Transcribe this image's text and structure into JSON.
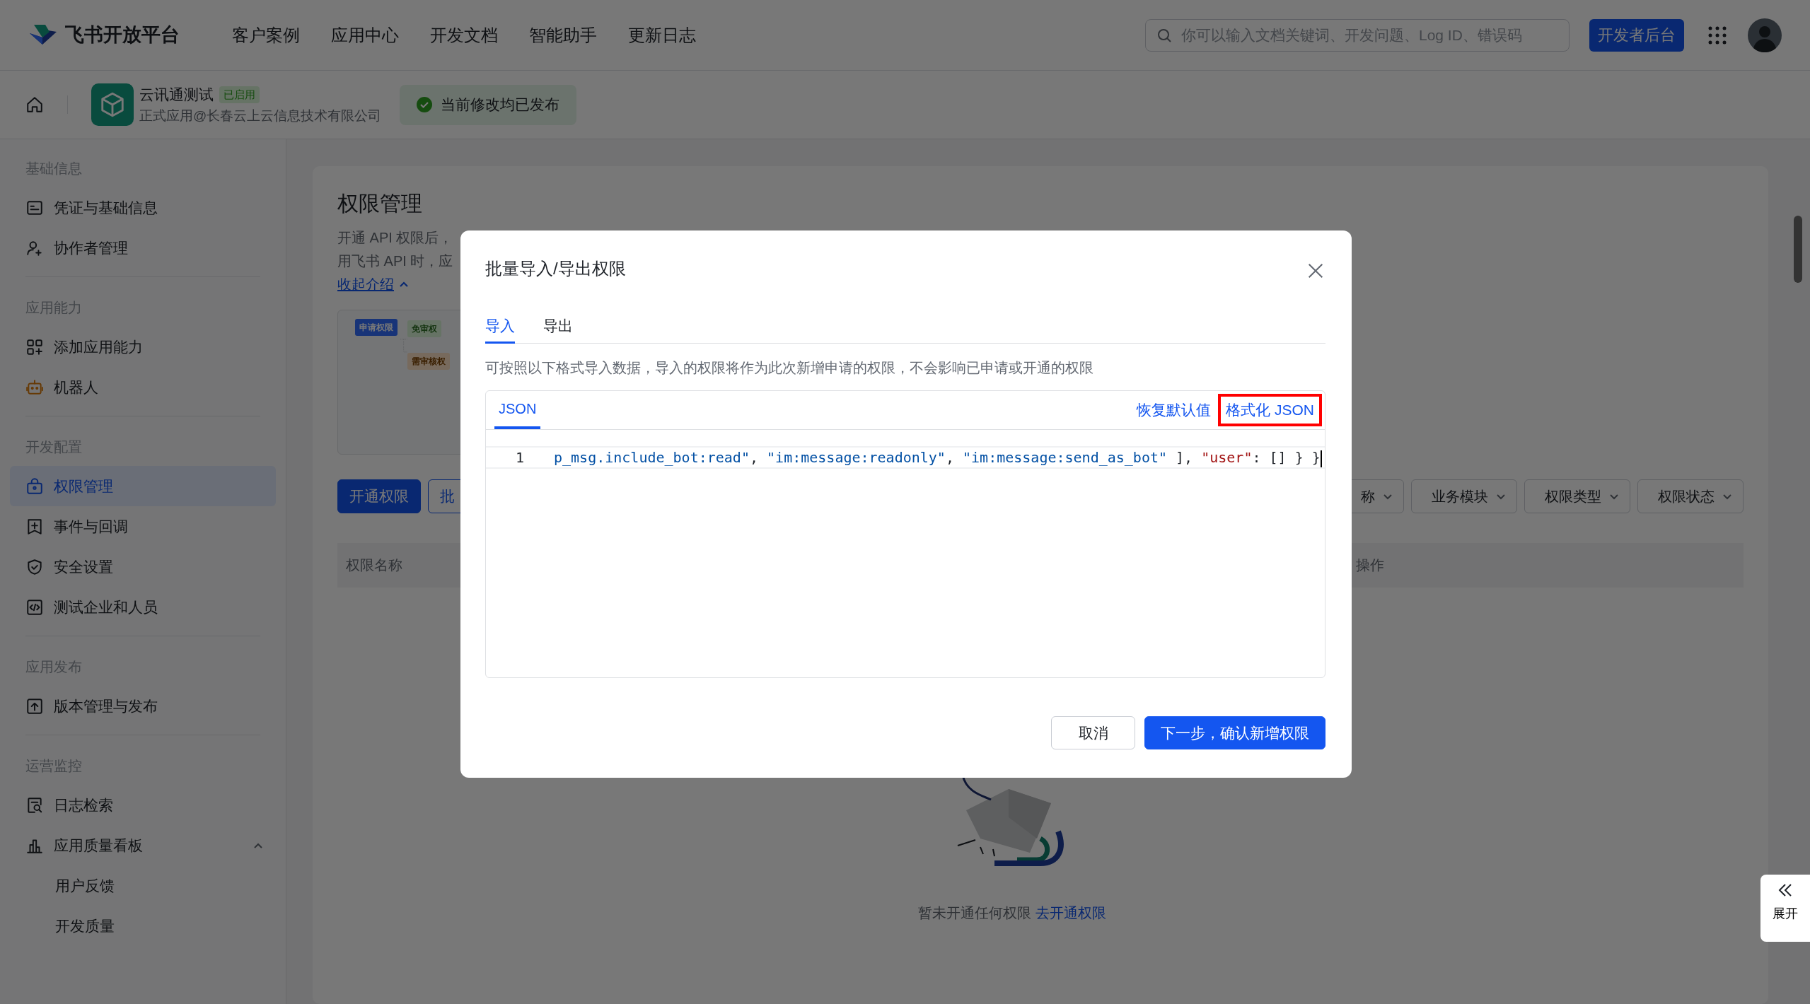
{
  "top_nav": {
    "logo_text": "飞书开放平台",
    "links": [
      {
        "label": "客户案例"
      },
      {
        "label": "应用中心"
      },
      {
        "label": "开发文档"
      },
      {
        "label": "智能助手"
      },
      {
        "label": "更新日志"
      }
    ],
    "search": {
      "placeholder": "你可以输入文档关键词、开发问题、Log ID、错误码"
    },
    "console_button": "开发者后台"
  },
  "app_bar": {
    "app_name": "云讯通测试",
    "app_badge": "已启用",
    "app_org": "正式应用@长春云上云信息技术有限公司",
    "publish_status": "当前修改均已发布"
  },
  "sidebar": {
    "sections": [
      {
        "title": "基础信息",
        "items": [
          {
            "label": "凭证与基础信息",
            "kind": "card",
            "selected": false
          },
          {
            "label": "协作者管理",
            "kind": "user-plus",
            "selected": false
          }
        ]
      },
      {
        "title": "应用能力",
        "items": [
          {
            "label": "添加应用能力",
            "kind": "grid-plus",
            "selected": false
          },
          {
            "label": "机器人",
            "kind": "robot",
            "selected": false
          }
        ]
      },
      {
        "title": "开发配置",
        "items": [
          {
            "label": "权限管理",
            "kind": "lock-bag",
            "selected": true
          },
          {
            "label": "事件与回调",
            "kind": "message-plus",
            "selected": false
          },
          {
            "label": "安全设置",
            "kind": "shield",
            "selected": false
          },
          {
            "label": "测试企业和人员",
            "kind": "code",
            "selected": false
          }
        ]
      },
      {
        "title": "应用发布",
        "items": [
          {
            "label": "版本管理与发布",
            "kind": "upload",
            "selected": false
          }
        ]
      },
      {
        "title": "运营监控",
        "items": [
          {
            "label": "日志检索",
            "kind": "log-search",
            "selected": false
          },
          {
            "label": "应用质量看板",
            "kind": "bar-chart",
            "selected": false,
            "expanded": true,
            "children": [
              {
                "label": "用户反馈",
                "selected": false
              },
              {
                "label": "开发质量",
                "selected": false
              }
            ]
          }
        ]
      }
    ]
  },
  "page": {
    "title": "权限管理",
    "description_lines": [
      "开通 API 权限后，",
      "用飞书 API 时，应"
    ],
    "collapse_link": "收起介绍",
    "diagram_nodes": [
      {
        "label": "申请权限",
        "kind": "apply"
      },
      {
        "label": "免审权",
        "kind": "free"
      },
      {
        "label": "需审核权",
        "kind": "review"
      }
    ],
    "buttons": [
      {
        "label": "开通权限",
        "kind": "primary"
      },
      {
        "label": "批",
        "kind": "outline"
      }
    ],
    "filters": [
      {
        "label": "称"
      },
      {
        "label": "业务模块"
      },
      {
        "label": "权限类型"
      },
      {
        "label": "权限状态"
      }
    ],
    "table": {
      "columns": [
        "权限名称",
        "操作"
      ]
    },
    "empty_state": {
      "message": "暂未开通任何权限",
      "link": "去开通权限"
    }
  },
  "modal": {
    "title": "批量导入/导出权限",
    "tabs": [
      {
        "label": "导入",
        "selected": true
      },
      {
        "label": "导出",
        "selected": false
      }
    ],
    "description": "可按照以下格式导入数据，导入的权限将作为此次新增申请的权限，不会影响已申请或开通的权限",
    "editor": {
      "tabs": [
        {
          "label": "JSON",
          "selected": true
        }
      ],
      "actions": [
        {
          "label": "恢复默认值",
          "highlighted": false
        },
        {
          "label": "格式化 JSON",
          "highlighted": true
        }
      ],
      "lines": [
        {
          "number": "1",
          "tokens": [
            {
              "text": "p_msg.include_bot:read\"",
              "kind": "string"
            },
            {
              "text": ", ",
              "kind": "punct"
            },
            {
              "text": "\"im:message:readonly\"",
              "kind": "string"
            },
            {
              "text": ", ",
              "kind": "punct"
            },
            {
              "text": "\"im:message:send_as_bot\"",
              "kind": "string"
            },
            {
              "text": " ], ",
              "kind": "punct"
            },
            {
              "text": "\"user\"",
              "kind": "key"
            },
            {
              "text": ": [] } }",
              "kind": "punct"
            }
          ]
        }
      ]
    },
    "buttons": [
      {
        "label": "取消",
        "kind": "secondary"
      },
      {
        "label": "下一步，确认新增权限",
        "kind": "primary"
      }
    ]
  },
  "expand_tab": {
    "label": "展开"
  }
}
